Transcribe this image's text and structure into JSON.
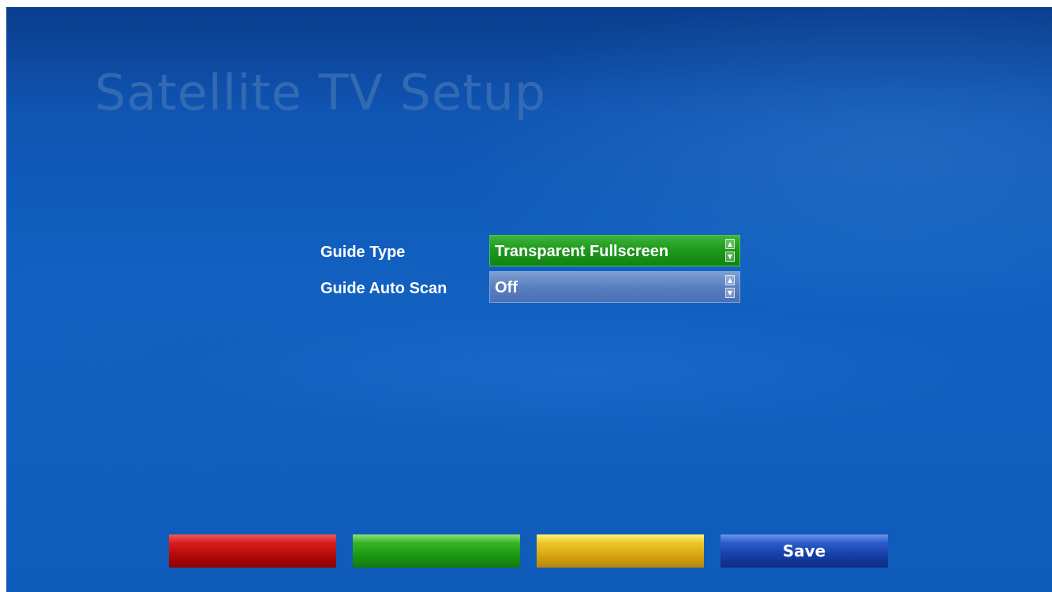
{
  "screen": {
    "title": "Satellite TV Setup"
  },
  "settings": [
    {
      "label": "Guide Type",
      "value": "Transparent Fullscreen",
      "selected": true
    },
    {
      "label": "Guide Auto Scan",
      "value": "Off",
      "selected": false
    }
  ],
  "spin_icons": {
    "up": "chevron-up-icon",
    "down": "chevron-down-icon",
    "up_glyph": "▲",
    "down_glyph": "▼"
  },
  "buttons": {
    "red": {
      "label": "",
      "color": "#c81010"
    },
    "green": {
      "label": "",
      "color": "#22a01a"
    },
    "yellow": {
      "label": "",
      "color": "#e2b51c"
    },
    "blue": {
      "label": "Save",
      "color": "#1a45b0"
    }
  },
  "colors": {
    "background": "#115fbe",
    "selected_field": "#1e9a1c",
    "unselected_field": "#5a7fc0",
    "title_text": "#3a6fb5"
  }
}
